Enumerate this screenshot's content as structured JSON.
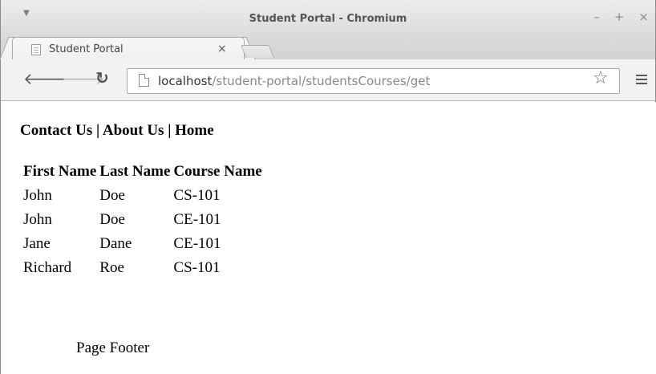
{
  "window": {
    "title": "Student Portal - Chromium",
    "controls": {
      "minimize": "–",
      "maximize": "+",
      "close": "×"
    }
  },
  "tab": {
    "label": "Student Portal",
    "close": "×"
  },
  "toolbar": {
    "back_icon": "arrow-left-icon",
    "forward_icon": "arrow-right-icon",
    "reload_icon": "reload-icon",
    "url_host": "localhost",
    "url_path": "/student-portal/studentsCourses/get",
    "bookmark_icon": "star-icon",
    "menu_icon": "hamburger-menu-icon"
  },
  "nav": {
    "contact": "Contact Us",
    "about": "About Us",
    "home": "Home",
    "separator": " | "
  },
  "table": {
    "headers": [
      "First Name",
      "Last Name",
      "Course Name"
    ],
    "rows": [
      [
        "John",
        "Doe",
        "CS-101"
      ],
      [
        "John",
        "Doe",
        "CE-101"
      ],
      [
        "Jane",
        "Dane",
        "CE-101"
      ],
      [
        "Richard",
        "Roe",
        "CS-101"
      ]
    ]
  },
  "footer": {
    "text": "Page Footer"
  }
}
